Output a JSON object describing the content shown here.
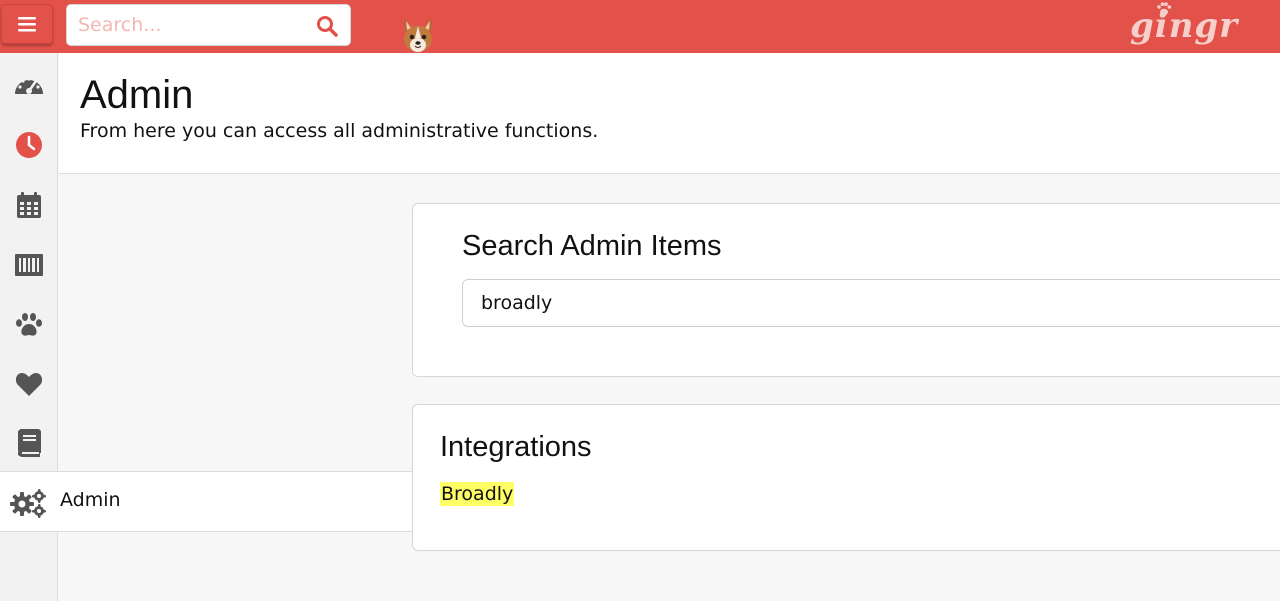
{
  "topbar": {
    "search": {
      "placeholder": "Search...",
      "value": ""
    },
    "logo_text": "gingr",
    "colors": {
      "brand": "#e2524b"
    }
  },
  "sidebar": {
    "items": [
      {
        "name": "dashboard-icon"
      },
      {
        "name": "clock-icon"
      },
      {
        "name": "calendar-icon"
      },
      {
        "name": "barcode-icon"
      },
      {
        "name": "paw-icon"
      },
      {
        "name": "heart-icon"
      },
      {
        "name": "book-icon"
      }
    ],
    "admin_label": "Admin"
  },
  "header": {
    "title": "Admin",
    "subtitle": "From here you can access all administrative functions."
  },
  "admin_search": {
    "title": "Search Admin Items",
    "value": "broadly"
  },
  "results": {
    "category": "Integrations",
    "items": [
      {
        "label": "Broadly"
      }
    ]
  }
}
